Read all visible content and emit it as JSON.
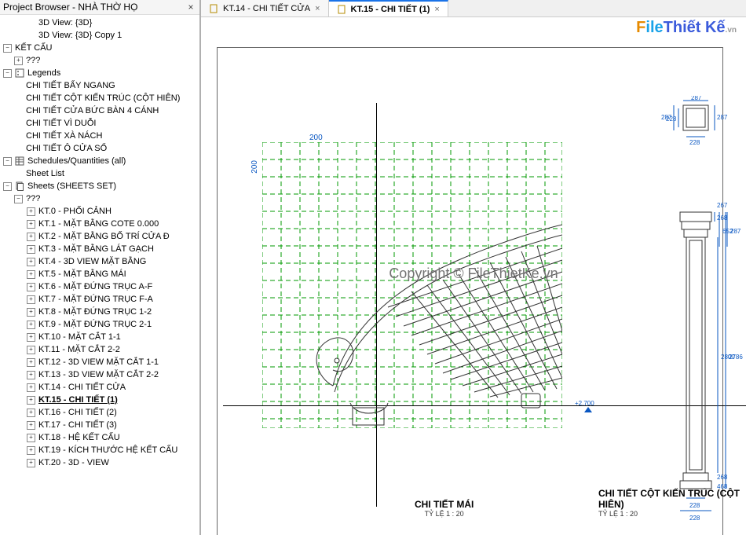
{
  "panel": {
    "title": "Project Browser - NHÀ THỜ HỌ",
    "close": "×"
  },
  "tree": [
    {
      "lvl": 2,
      "tw": "blank",
      "icon": "",
      "label": "3D View: {3D}"
    },
    {
      "lvl": 2,
      "tw": "blank",
      "icon": "",
      "label": "3D View: {3D} Copy 1"
    },
    {
      "lvl": 0,
      "tw": "minus",
      "icon": "",
      "label": "KẾT CẤU"
    },
    {
      "lvl": 1,
      "tw": "plus",
      "icon": "",
      "label": "???"
    },
    {
      "lvl": 0,
      "tw": "minus",
      "icon": "legend",
      "label": "Legends"
    },
    {
      "lvl": 1,
      "tw": "blank",
      "icon": "",
      "label": "CHI TIẾT BẨY NGANG"
    },
    {
      "lvl": 1,
      "tw": "blank",
      "icon": "",
      "label": "CHI TIẾT CỘT KIẾN TRÚC (CỘT HIÊN)"
    },
    {
      "lvl": 1,
      "tw": "blank",
      "icon": "",
      "label": "CHI TIẾT CỬA BỨC BÀN 4 CÁNH"
    },
    {
      "lvl": 1,
      "tw": "blank",
      "icon": "",
      "label": "CHI TIẾT VÌ DUỖI"
    },
    {
      "lvl": 1,
      "tw": "blank",
      "icon": "",
      "label": "CHI TIẾT XÀ NÁCH"
    },
    {
      "lvl": 1,
      "tw": "blank",
      "icon": "",
      "label": "CHI TIẾT Ô CỬA SỔ"
    },
    {
      "lvl": 0,
      "tw": "minus",
      "icon": "sched",
      "label": "Schedules/Quantities (all)"
    },
    {
      "lvl": 1,
      "tw": "blank",
      "icon": "",
      "label": "Sheet List"
    },
    {
      "lvl": 0,
      "tw": "minus",
      "icon": "sheets",
      "label": "Sheets (SHEETS SET)"
    },
    {
      "lvl": 1,
      "tw": "minus",
      "icon": "",
      "label": "???"
    },
    {
      "lvl": 2,
      "tw": "plus",
      "icon": "",
      "label": "KT.0 - PHỐI CẢNH"
    },
    {
      "lvl": 2,
      "tw": "plus",
      "icon": "",
      "label": "KT.1 - MẶT BẰNG COTE 0.000"
    },
    {
      "lvl": 2,
      "tw": "plus",
      "icon": "",
      "label": "KT.2 - MẶT BẰNG BỐ TRÍ CỬA Đ"
    },
    {
      "lvl": 2,
      "tw": "plus",
      "icon": "",
      "label": "KT.3 - MẶT BẰNG LÁT GẠCH"
    },
    {
      "lvl": 2,
      "tw": "plus",
      "icon": "",
      "label": "KT.4 - 3D VIEW MẶT BẰNG"
    },
    {
      "lvl": 2,
      "tw": "plus",
      "icon": "",
      "label": "KT.5 - MẶT BẰNG MÁI"
    },
    {
      "lvl": 2,
      "tw": "plus",
      "icon": "",
      "label": "KT.6 - MẶT ĐỨNG TRỤC A-F"
    },
    {
      "lvl": 2,
      "tw": "plus",
      "icon": "",
      "label": "KT.7 - MẶT ĐỨNG TRỤC F-A"
    },
    {
      "lvl": 2,
      "tw": "plus",
      "icon": "",
      "label": "KT.8 - MẶT ĐỨNG TRỤC 1-2"
    },
    {
      "lvl": 2,
      "tw": "plus",
      "icon": "",
      "label": "KT.9 - MẶT ĐỨNG TRỤC 2-1"
    },
    {
      "lvl": 2,
      "tw": "plus",
      "icon": "",
      "label": "KT.10 - MẶT CẮT 1-1"
    },
    {
      "lvl": 2,
      "tw": "plus",
      "icon": "",
      "label": "KT.11 - MẶT CẮT 2-2"
    },
    {
      "lvl": 2,
      "tw": "plus",
      "icon": "",
      "label": "KT.12 - 3D VIEW MẶT CẮT 1-1"
    },
    {
      "lvl": 2,
      "tw": "plus",
      "icon": "",
      "label": "KT.13 - 3D VIEW MẶT CẮT 2-2"
    },
    {
      "lvl": 2,
      "tw": "plus",
      "icon": "",
      "label": "KT.14 - CHI TIẾT CỬA"
    },
    {
      "lvl": 2,
      "tw": "plus",
      "icon": "",
      "label": "KT.15 - CHI TIẾT (1)",
      "sel": true
    },
    {
      "lvl": 2,
      "tw": "plus",
      "icon": "",
      "label": "KT.16 - CHI TIẾT (2)"
    },
    {
      "lvl": 2,
      "tw": "plus",
      "icon": "",
      "label": "KT.17 - CHI TIẾT (3)"
    },
    {
      "lvl": 2,
      "tw": "plus",
      "icon": "",
      "label": "KT.18 - HỆ KẾT CẤU"
    },
    {
      "lvl": 2,
      "tw": "plus",
      "icon": "",
      "label": "KT.19 - KÍCH THƯỚC HỆ KẾT CẤU"
    },
    {
      "lvl": 2,
      "tw": "plus",
      "icon": "",
      "label": "KT.20 - 3D - VIEW"
    }
  ],
  "tabs": [
    {
      "label": "KT.14 - CHI TIẾT CỬA",
      "active": false
    },
    {
      "label": "KT.15 - CHI TIẾT (1)",
      "active": true
    }
  ],
  "dims": {
    "grid200_h": "200",
    "grid200_v": "200",
    "elev": "+2.700"
  },
  "col_dims": {
    "top_a": "287",
    "top_b": "287",
    "top_c": "228",
    "top_d": "228",
    "top_e": "287",
    "cap_a": "267",
    "cap_b": "268",
    "cap_c": "652",
    "cap_d": "287",
    "shaft": "2800",
    "shaft2": "2786",
    "base_a": "268",
    "base_b": "468",
    "foot_a": "228",
    "foot_b": "228"
  },
  "titles": {
    "v1": "CHI TIẾT MÁI",
    "v1s": "TỶ LỆ   1 : 20",
    "v2": "CHI TIẾT CỘT KIẾN TRÚC (CỘT HIÊN)",
    "v2s": "TỶ LỆ   1 : 20"
  },
  "watermark": {
    "center": "Copyright © FileThietKe.vn",
    "logo_f": "F",
    "logo_ile": "ile",
    "logo_tk": "Thiết Kế",
    "logo_vn": ".vn"
  }
}
